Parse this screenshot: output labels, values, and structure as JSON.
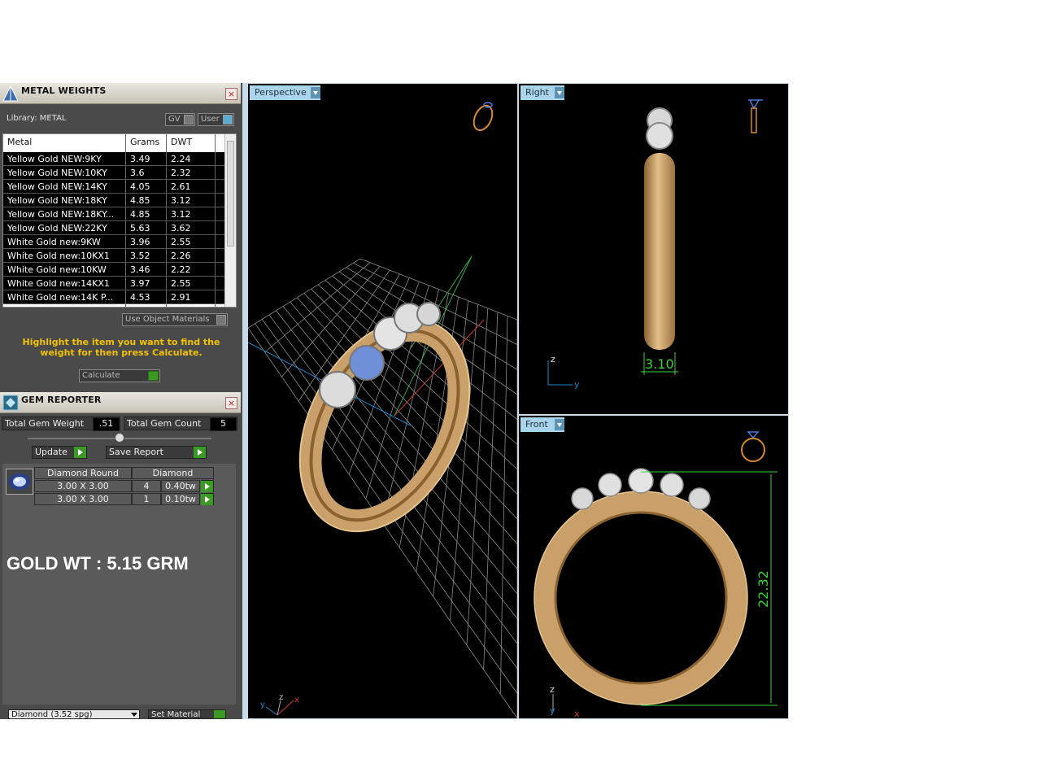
{
  "metal_weights": {
    "title": "METAL WEIGHTS",
    "close_label": "×",
    "library_label": "Library: METAL",
    "gv_label": "GV",
    "user_label": "User",
    "headers": [
      "Metal",
      "Grams",
      "DWT"
    ],
    "rows": [
      {
        "metal": "Yellow Gold NEW:9KY",
        "grams": "3.49",
        "dwt": "2.24"
      },
      {
        "metal": "Yellow Gold NEW:10KY",
        "grams": "3.6",
        "dwt": "2.32"
      },
      {
        "metal": "Yellow Gold NEW:14KY",
        "grams": "4.05",
        "dwt": "2.61"
      },
      {
        "metal": "Yellow Gold NEW:18KY",
        "grams": "4.85",
        "dwt": "3.12"
      },
      {
        "metal": "Yellow Gold NEW:18KY...",
        "grams": "4.85",
        "dwt": "3.12"
      },
      {
        "metal": "Yellow Gold NEW:22KY",
        "grams": "5.63",
        "dwt": "3.62"
      },
      {
        "metal": "White Gold new:9KW",
        "grams": "3.96",
        "dwt": "2.55"
      },
      {
        "metal": "White Gold new:10KX1",
        "grams": "3.52",
        "dwt": "2.26"
      },
      {
        "metal": "White Gold new:10KW",
        "grams": "3.46",
        "dwt": "2.22"
      },
      {
        "metal": "White Gold new:14KX1",
        "grams": "3.97",
        "dwt": "2.55"
      },
      {
        "metal": "White Gold new:14K P...",
        "grams": "4.53",
        "dwt": "2.91"
      }
    ],
    "use_object_materials": "Use Object Materials",
    "hint": "Highlight the item you want to find the weight for then press Calculate.",
    "calculate_label": "Calculate"
  },
  "gem_reporter": {
    "title": "GEM REPORTER",
    "close_label": "×",
    "total_weight_label": "Total Gem Weight",
    "total_weight_value": ".51",
    "total_count_label": "Total Gem Count",
    "total_count_value": "5",
    "update_label": "Update",
    "save_report_label": "Save Report",
    "table_headers": [
      "Diamond Round",
      "Diamond"
    ],
    "gems": [
      {
        "size": "3.00 X 3.00",
        "count": "4",
        "weight": "0.40tw"
      },
      {
        "size": "3.00 X 3.00",
        "count": "1",
        "weight": "0.10tw"
      }
    ],
    "gold_weight_note": "GOLD WT : 5.15 GRM",
    "material_select": "Diamond    (3.52 spg)",
    "set_material_label": "Set Material"
  },
  "viewports": {
    "perspective_label": "Perspective",
    "right_label": "Right",
    "front_label": "Front",
    "right_dimension": "3.10",
    "front_dimension": "22.32",
    "axis_x": "x",
    "axis_y": "y",
    "axis_z": "z"
  },
  "colors": {
    "gold": "#c9a06a",
    "gold_dark": "#8a6230",
    "hint_yellow": "#f2c200",
    "viewport_label_bg": "#a9d4ea",
    "grid": "#8a8a8a",
    "dim_green": "#3ad23a"
  }
}
